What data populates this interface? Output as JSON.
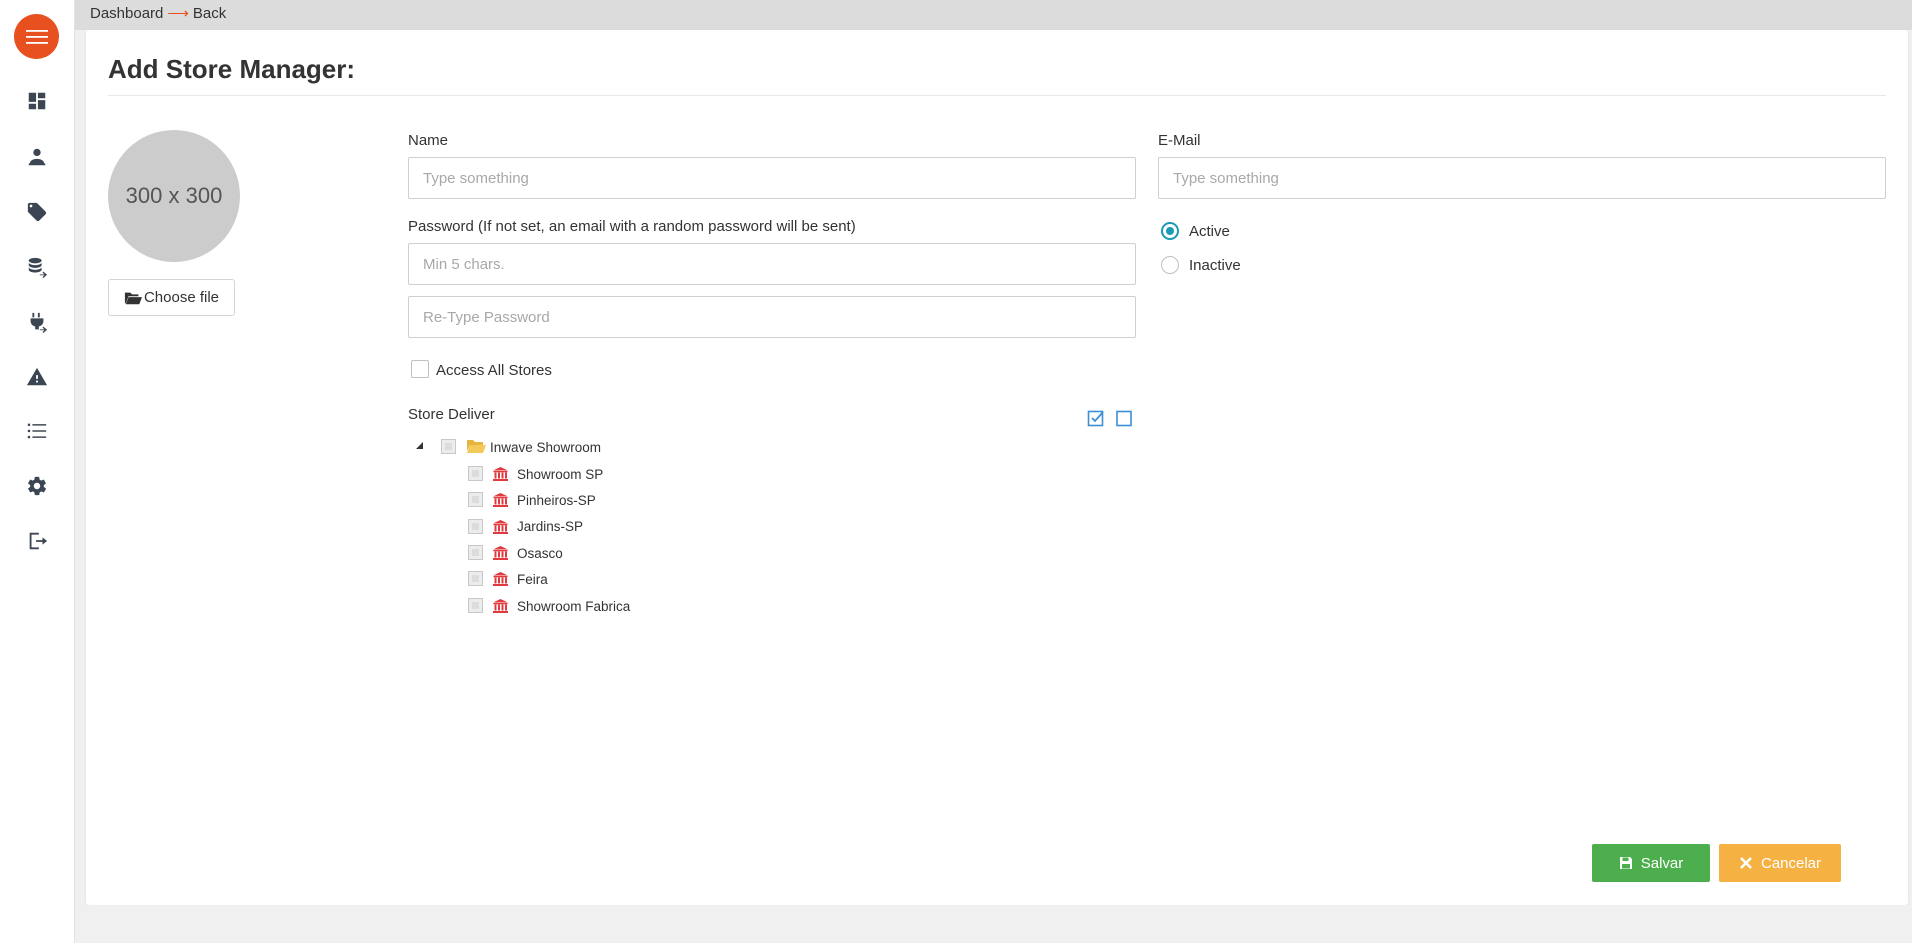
{
  "breadcrumb": {
    "home": "Dashboard",
    "arrow": "⟶",
    "back": "Back"
  },
  "page": {
    "title": "Add Store Manager:"
  },
  "avatar": {
    "placeholder_text": "300 x 300",
    "choose_file_label": "Choose file"
  },
  "form": {
    "name": {
      "label": "Name",
      "placeholder": "Type something",
      "value": ""
    },
    "email": {
      "label": "E-Mail",
      "placeholder": "Type something",
      "value": ""
    },
    "password": {
      "label": "Password (If not set, an email with a random password will be sent)",
      "placeholder": "Min 5 chars.",
      "value": ""
    },
    "retype_password": {
      "placeholder": "Re-Type Password",
      "value": ""
    },
    "status": {
      "options": [
        {
          "label": "Active",
          "checked": true
        },
        {
          "label": "Inactive",
          "checked": false
        }
      ]
    },
    "access_all_stores": {
      "label": "Access All Stores",
      "checked": false
    },
    "store_deliver": {
      "label": "Store Deliver",
      "root": {
        "label": "Inwave Showroom",
        "expanded": true
      },
      "stores": [
        "Showroom SP",
        "Pinheiros-SP",
        "Jardins-SP",
        "Osasco",
        "Feira",
        "Showroom Fabrica"
      ]
    }
  },
  "actions": {
    "save_label": "Salvar",
    "cancel_label": "Cancelar"
  },
  "sidebar": {
    "icons": [
      "dashboard-icon",
      "user-icon",
      "tag-icon",
      "database-import-icon",
      "plug-import-icon",
      "warning-icon",
      "list-icon",
      "gear-icon",
      "logout-icon"
    ]
  },
  "colors": {
    "accent": "#e8501f",
    "save": "#4cae4c",
    "cancel": "#f6b143",
    "radio": "#1a9bb5",
    "store_icon": "#e0393e",
    "folder": "#f0c14b"
  }
}
